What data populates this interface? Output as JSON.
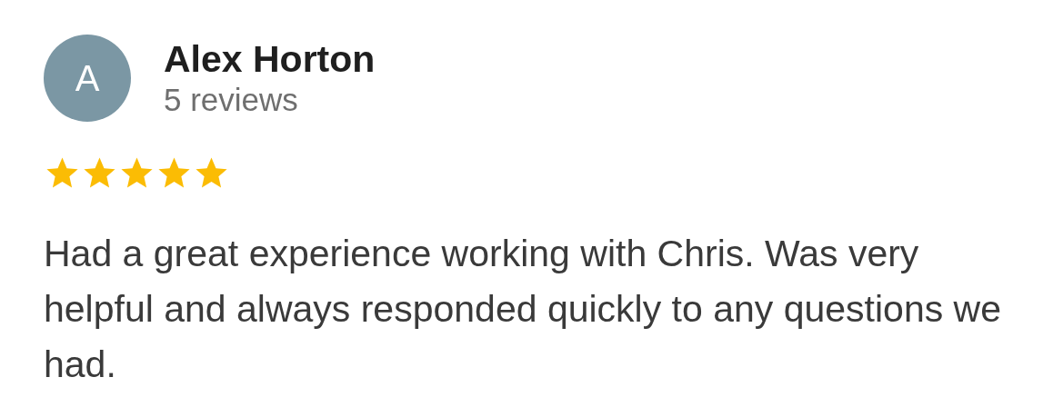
{
  "review": {
    "avatar_letter": "A",
    "author": "Alex Horton",
    "review_count": "5 reviews",
    "stars": 5,
    "text": "Had a great experience working with Chris. Was very helpful and always responded quickly to any questions we had."
  }
}
